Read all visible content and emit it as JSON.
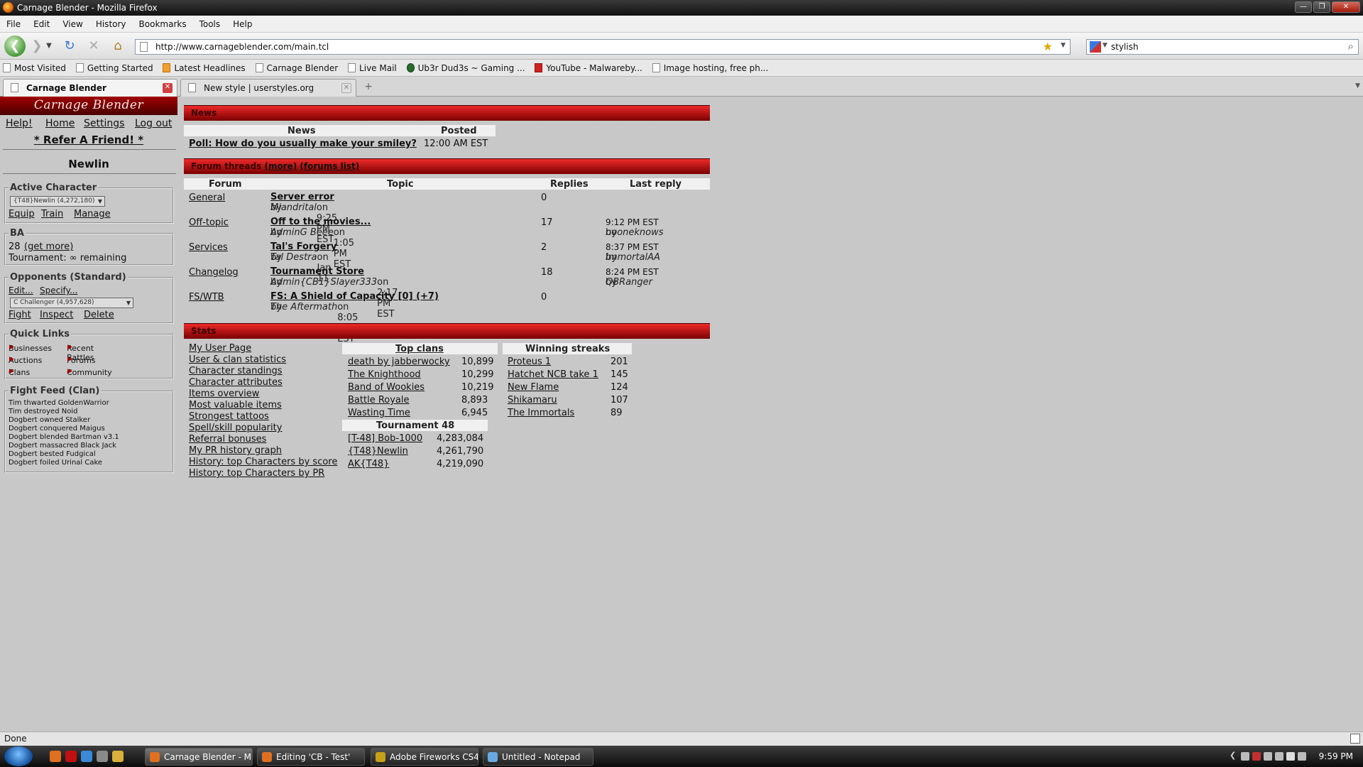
{
  "window": {
    "title": "Carnage Blender - Mozilla Firefox"
  },
  "menu": [
    "File",
    "Edit",
    "View",
    "History",
    "Bookmarks",
    "Tools",
    "Help"
  ],
  "nav": {
    "url": "http://www.carnageblender.com/main.tcl",
    "search": "stylish"
  },
  "bookmarks": [
    "Most Visited",
    "Getting Started",
    "Latest Headlines",
    "Carnage Blender",
    "Live Mail",
    "Ub3r Dud3s ~ Gaming ...",
    "YouTube - Malwareby...",
    "Image hosting, free ph..."
  ],
  "tabs": [
    {
      "label": "Carnage Blender",
      "active": true
    },
    {
      "label": "New style | userstyles.org",
      "active": false
    }
  ],
  "site": {
    "logo": "Carnage Blender",
    "top_nav": [
      "Help!",
      "Home",
      "Settings",
      "Log out"
    ],
    "refer": "* Refer A Friend! *",
    "character_name": "Newlin",
    "active_character": {
      "legend": "Active Character",
      "selected": "{T48}Newlin (4,272,180)",
      "actions": [
        "Equip",
        "Train",
        "Manage"
      ]
    },
    "ba": {
      "legend": "BA",
      "value": "28",
      "get_more": "(get more)",
      "tournament": "Tournament: ∞ remaining"
    },
    "opponents": {
      "legend": "Opponents (Standard)",
      "edit": "Edit...",
      "specify": "Specify...",
      "selected": "C Challenger (4,957,628)",
      "actions": [
        "Fight",
        "Inspect",
        "Delete"
      ]
    },
    "quick_links": {
      "legend": "Quick Links",
      "items": [
        "Businesses",
        "Recent Battles",
        "Auctions",
        "Forums",
        "Clans",
        "Community"
      ]
    },
    "fight_feed": {
      "legend": "Fight Feed (Clan)",
      "items": [
        "Tim thwarted GoldenWarrior",
        "Tim destroyed Noid",
        "Dogbert owned Stalker",
        "Dogbert conquered Maigus",
        "Dogbert blended Bartman v3.1",
        "Dogbert massacred Black Jack",
        "Dogbert bested Fudgical",
        "Dogbert foiled Urinal Cake"
      ]
    }
  },
  "news": {
    "bar_title": "News",
    "col_news": "News",
    "col_posted": "Posted",
    "item_title": "Poll: How do you usually make your smiley?",
    "item_posted": "12:00 AM EST"
  },
  "forum": {
    "bar_title": "Forum threads",
    "more": "(more)",
    "list": "(forums list)",
    "cols": [
      "Forum",
      "Topic",
      "Replies",
      "Last reply"
    ],
    "rows": [
      {
        "forum": "General",
        "topic": "Server error",
        "by_prefix": "by",
        "author": "Miandrital",
        "by_suffix": "on 9:25 PM EST",
        "replies": "0",
        "last_time": "",
        "last_by": "",
        "last_user": ""
      },
      {
        "forum": "Off-topic",
        "topic": "Off to the movies...",
        "by_prefix": "by",
        "author": "AdminG Beee",
        "by_suffix": "on 1:05 PM EST",
        "replies": "17",
        "last_time": "9:12 PM EST",
        "last_by": "by",
        "last_user": "nooneknows"
      },
      {
        "forum": "Services",
        "topic": "Tal's Forgery",
        "by_prefix": "by",
        "author": "Tal Destra",
        "by_suffix": "on Jan 11",
        "replies": "2",
        "last_time": "8:37 PM EST",
        "last_by": "by",
        "last_user": "ImmortalAA"
      },
      {
        "forum": "Changelog",
        "topic": "Tournament Store",
        "by_prefix": "by",
        "author": "Admin{CB1}Slayer333",
        "by_suffix": "on 2:17 PM EST",
        "replies": "18",
        "last_time": "8:24 PM EST",
        "last_by": "by",
        "last_user": "QBRanger"
      },
      {
        "forum": "FS/WTB",
        "topic": "FS: A Shield of Capacity [0] (+7)",
        "by_prefix": "by",
        "author": "The Aftermath",
        "by_suffix": "on 8:05 PM EST",
        "replies": "0",
        "last_time": "",
        "last_by": "",
        "last_user": ""
      }
    ]
  },
  "stats": {
    "bar_title": "Stats",
    "links": [
      "My User Page",
      "User & clan statistics",
      "Character standings",
      "Character attributes",
      "Items overview",
      "Most valuable items",
      "Strongest tattoos",
      "Spell/skill popularity",
      "Referral bonuses",
      "My PR history graph",
      "History: top Characters by score",
      "History: top Characters by PR"
    ],
    "top_clans_title": "Top clans",
    "top_clans": [
      {
        "name": "death by jabberwocky",
        "score": "10,899"
      },
      {
        "name": "The Knighthood",
        "score": "10,299"
      },
      {
        "name": "Band of Wookies",
        "score": "10,219"
      },
      {
        "name": "Battle Royale",
        "score": "8,893"
      },
      {
        "name": "Wasting Time",
        "score": "6,945"
      }
    ],
    "tournament_title": "Tournament 48",
    "tournament": [
      {
        "name": "[T-48] Bob-1000",
        "score": "4,283,084"
      },
      {
        "name": "{T48}Newlin",
        "score": "4,261,790"
      },
      {
        "name": "AK{T48}",
        "score": "4,219,090"
      }
    ],
    "streaks_title": "Winning streaks",
    "streaks": [
      {
        "name": "Proteus 1",
        "score": "201"
      },
      {
        "name": "Hatchet NCB take 1",
        "score": "145"
      },
      {
        "name": "New Flame",
        "score": "124"
      },
      {
        "name": "Shikamaru",
        "score": "107"
      },
      {
        "name": "The Immortals",
        "score": "89"
      }
    ]
  },
  "status": {
    "text": "Done"
  },
  "taskbar": {
    "tasks": [
      "Carnage Blender - M...",
      "Editing 'CB - Test'",
      "Adobe Fireworks CS4...",
      "Untitled - Notepad"
    ],
    "clock": "9:59 PM"
  }
}
